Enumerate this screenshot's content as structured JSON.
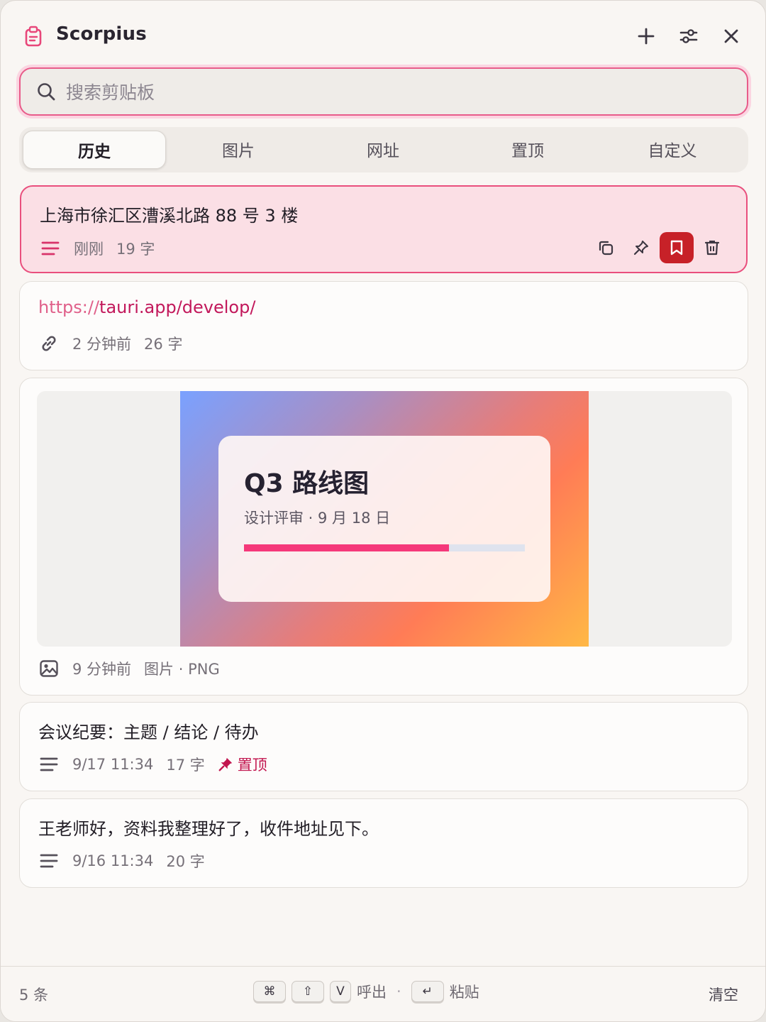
{
  "app": {
    "title": "Scorpius"
  },
  "header": {
    "icons": [
      "add-icon",
      "sliders-icon",
      "close-icon"
    ]
  },
  "search": {
    "placeholder": "搜索剪贴板",
    "value": ""
  },
  "tabs": [
    {
      "label": "历史",
      "active": true
    },
    {
      "label": "图片",
      "active": false
    },
    {
      "label": "网址",
      "active": false
    },
    {
      "label": "置顶",
      "active": false
    },
    {
      "label": "自定义",
      "active": false
    }
  ],
  "items": [
    {
      "type": "text",
      "content": "上海市徐汇区漕溪北路 88 号 3 楼",
      "time": "刚刚",
      "chars": "19 字",
      "selected": true,
      "icon": "text-lines-icon"
    },
    {
      "type": "url",
      "scheme": "https://",
      "rest": "tauri.app/develop/",
      "time": "2 分钟前",
      "chars": "26 字",
      "icon": "link-icon"
    },
    {
      "type": "image",
      "time": "9 分钟前",
      "kind": "图片 · PNG",
      "icon": "image-icon",
      "thumbnail": {
        "title": "Q3 路线图",
        "subtitle": "设计评审 · 9 月 18 日",
        "progress": 0.73
      }
    },
    {
      "type": "text",
      "content": "会议纪要：主题 / 结论 / 待办",
      "time": "9/17 11:34",
      "chars": "17 字",
      "pinned_label": "置顶",
      "icon": "text-lines-icon"
    },
    {
      "type": "text",
      "content": "王老师好，资料我整理好了，收件地址见下。",
      "time": "9/16 11:34",
      "chars": "20 字",
      "icon": "text-lines-icon"
    }
  ],
  "footer": {
    "count": "5 条",
    "keys": {
      "cmd": "⌘",
      "shift": "⇧",
      "v": "V",
      "enter": "↵"
    },
    "summon_label": "呼出",
    "paste_label": "粘贴",
    "clear_label": "清空"
  },
  "colors": {
    "accent": "#e94f7d",
    "selected_bg": "#fbdfe5",
    "bookmark": "#c72128",
    "pin": "#c2164f"
  }
}
